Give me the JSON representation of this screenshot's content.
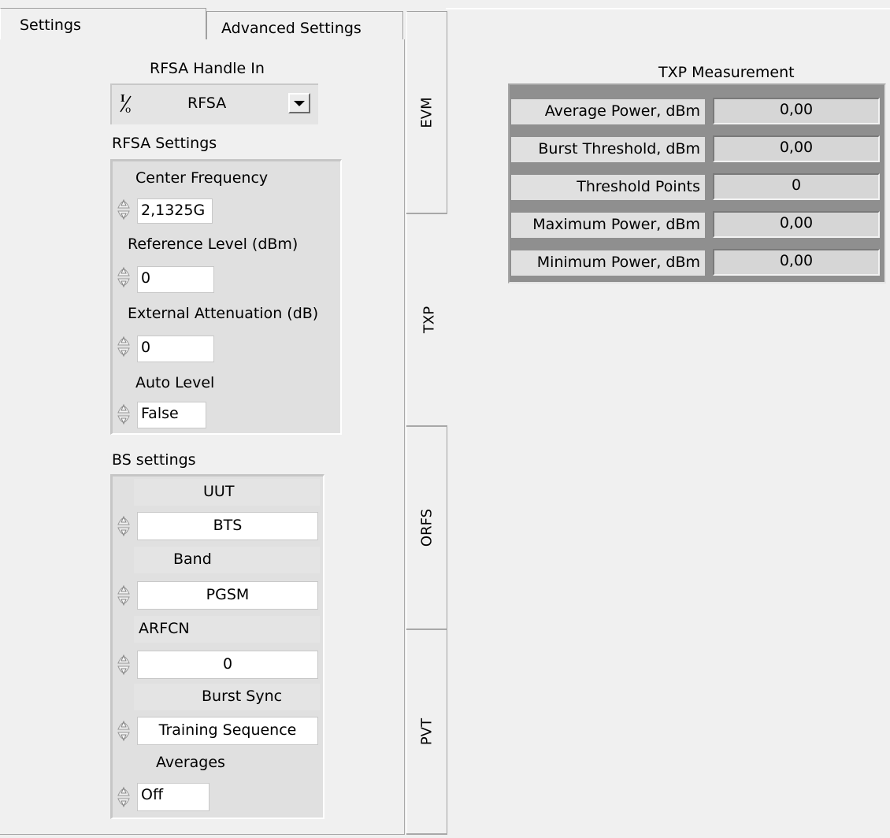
{
  "tabs": {
    "settings": "Settings",
    "advanced": "Advanced Settings"
  },
  "rfsa_handle": {
    "label": "RFSA Handle In",
    "io_glyph": "I/O",
    "value": "RFSA"
  },
  "rfsa_settings": {
    "title": "RFSA Settings",
    "center_frequency": {
      "label": "Center Frequency",
      "value": "2,1325G"
    },
    "reference_level": {
      "label": "Reference Level (dBm)",
      "value": "0"
    },
    "external_attenuation": {
      "label": "External Attenuation (dB)",
      "value": "0"
    },
    "auto_level": {
      "label": "Auto Level",
      "value": "False"
    }
  },
  "bs_settings": {
    "title": "BS settings",
    "uut": {
      "label": "UUT",
      "value": "BTS"
    },
    "band": {
      "label": "Band",
      "value": "PGSM"
    },
    "arfcn": {
      "label": "ARFCN",
      "value": "0"
    },
    "burst_sync": {
      "label": "Burst Sync",
      "value": "Training Sequence"
    },
    "averages": {
      "label": "Averages",
      "value": "Off"
    }
  },
  "vertical_tabs": {
    "evm": "EVM",
    "txp": "TXP",
    "orfs": "ORFS",
    "pvt": "PVT"
  },
  "txp_measurement": {
    "title": "TXP Measurement",
    "rows": [
      {
        "label": "Average Power, dBm",
        "value": "0,00"
      },
      {
        "label": "Burst Threshold, dBm",
        "value": "0,00"
      },
      {
        "label": "Threshold Points",
        "value": "0"
      },
      {
        "label": "Maximum Power, dBm",
        "value": "0,00"
      },
      {
        "label": "Minimum Power, dBm",
        "value": "0,00"
      }
    ]
  }
}
